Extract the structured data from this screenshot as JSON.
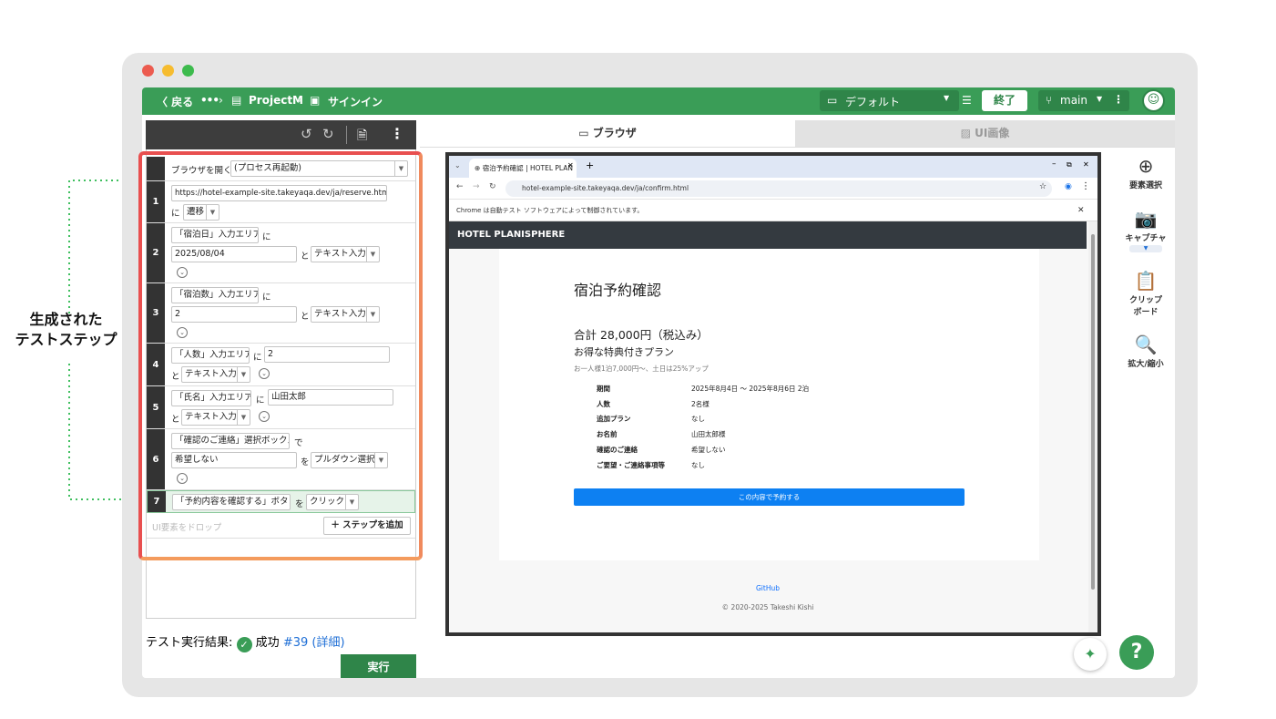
{
  "annotation": {
    "line1": "生成された",
    "line2": "テストステップ"
  },
  "topbar": {
    "back": "〈 戻る",
    "more": "•••",
    "project": "ProjectM",
    "page": "サインイン",
    "environment": "デフォルト",
    "end_label": "終了",
    "branch": "main"
  },
  "steps": {
    "open_browser": "ブラウザを開く",
    "open_option": "(プロセス再起動)",
    "s1_url": "https://hotel-example-site.takeyaqa.dev/ja/reserve.html?pla",
    "s1_ni": "に",
    "s1_action": "遷移",
    "s2_target": "「宿泊日」入力エリア",
    "s2_ni": "に",
    "s2_value": "2025/08/04",
    "s2_to": "と",
    "s2_action": "テキスト入力",
    "s3_target": "「宿泊数」入力エリア",
    "s3_ni": "に",
    "s3_value": "2",
    "s3_to": "と",
    "s3_action": "テキスト入力",
    "s4_target": "「人数」入力エリア",
    "s4_ni": "に",
    "s4_value": "2",
    "s4_to": "と",
    "s4_action": "テキスト入力",
    "s5_target": "「氏名」入力エリア",
    "s5_ni": "に",
    "s5_value": "山田太郎",
    "s5_to": "と",
    "s5_action": "テキスト入力",
    "s6_target": "「確認のご連絡」選択ボックス",
    "s6_de": "で",
    "s6_value": "希望しない",
    "s6_wo": "を",
    "s6_action": "プルダウン選択",
    "s7_target": "「予約内容を確認する」ボタン",
    "s7_wo": "を",
    "s7_action": "クリック",
    "drop_placeholder": "UI要素をドロップ",
    "add_step": "＋ ステップを追加",
    "numbers": [
      "1",
      "2",
      "3",
      "4",
      "5",
      "6",
      "7"
    ]
  },
  "result": {
    "label": "テスト実行結果:",
    "status": "成功",
    "run_id": "#39",
    "detail": "(詳細)",
    "run_button": "実行"
  },
  "tabs": {
    "browser": "ブラウザ",
    "ui_image": "UI画像"
  },
  "browser": {
    "tab_title": "宿泊予約確認 | HOTEL PLAN",
    "url": "hotel-example-site.takeyaqa.dev/ja/confirm.html",
    "automation_notice": "Chrome は自動テスト ソフトウェアによって制御されています。",
    "site_title": "HOTEL PLANISPHERE",
    "heading": "宿泊予約確認",
    "total": "合計 28,000円（税込み）",
    "plan": "お得な特典付きプラン",
    "plan_note": "お一人様1泊7,000円〜、土日は25%アップ",
    "details": [
      {
        "k": "期間",
        "v": "2025年8月4日 〜 2025年8月6日 2泊"
      },
      {
        "k": "人数",
        "v": "2名様"
      },
      {
        "k": "追加プラン",
        "v": "なし"
      },
      {
        "k": "お名前",
        "v": "山田太郎様"
      },
      {
        "k": "確認のご連絡",
        "v": "希望しない"
      },
      {
        "k": "ご要望・ご連絡事項等",
        "v": "なし"
      }
    ],
    "submit": "この内容で予約する",
    "github": "GitHub",
    "copyright": "© 2020-2025 Takeshi Kishi"
  },
  "tools": {
    "select": "要素選択",
    "capture": "キャプチャ",
    "clipboard_1": "クリップ",
    "clipboard_2": "ボード",
    "zoom": "拡大/縮小"
  },
  "help": "?",
  "colors": {
    "brand": "#3a9d57",
    "primary": "#0d80f2",
    "highlight": "#ee6352"
  }
}
